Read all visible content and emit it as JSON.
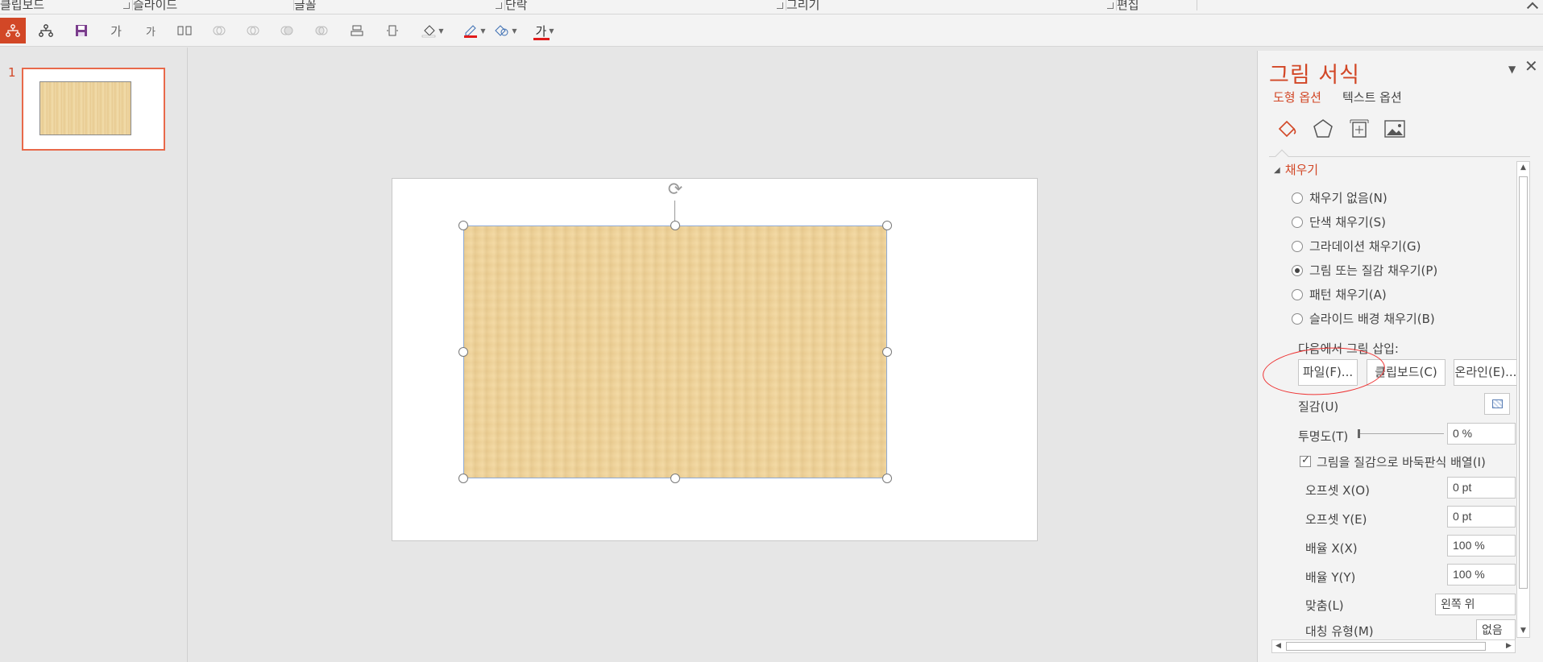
{
  "ribbon": {
    "groups": {
      "clipboard": "클립보드",
      "slides": "슬라이드",
      "font": "글꼴",
      "paragraph": "단락",
      "drawing": "그리기",
      "editing": "편집"
    }
  },
  "toolbar": {
    "font_a1": "가",
    "font_a2": "가",
    "font_color": "가",
    "accent_color": "#d24726",
    "font_color_bar": "#e01b1b"
  },
  "thumbnails": {
    "slide_number": "1"
  },
  "pane": {
    "title": "그림 서식",
    "tab_shape": "도형 옵션",
    "tab_text": "텍스트 옵션",
    "section_fill": "채우기",
    "radios": {
      "no_fill": "채우기 없음(N)",
      "solid": "단색 채우기(S)",
      "gradient": "그라데이션 채우기(G)",
      "picture": "그림 또는 질감 채우기(P)",
      "pattern": "패턴 채우기(A)",
      "slide_bg": "슬라이드 배경 채우기(B)"
    },
    "insert_from": "다음에서 그림 삽입:",
    "btn_file": "파일(F)...",
    "btn_clipboard": "클립보드(C)",
    "btn_online": "온라인(E)...",
    "texture_label": "질감(U)",
    "transparency_label": "투명도(T)",
    "transparency_value": "0 %",
    "tile_label": "그림을 질감으로 바둑판식 배열(I)",
    "offset_x_label": "오프셋 X(O)",
    "offset_x_value": "0 pt",
    "offset_y_label": "오프셋 Y(E)",
    "offset_y_value": "0 pt",
    "scale_x_label": "배율 X(X)",
    "scale_x_value": "100 %",
    "scale_y_label": "배율 Y(Y)",
    "scale_y_value": "100 %",
    "align_label": "맞춤(L)",
    "align_value": "왼쪽 위",
    "mirror_label": "대칭 유형(M)",
    "mirror_value": "없음"
  }
}
